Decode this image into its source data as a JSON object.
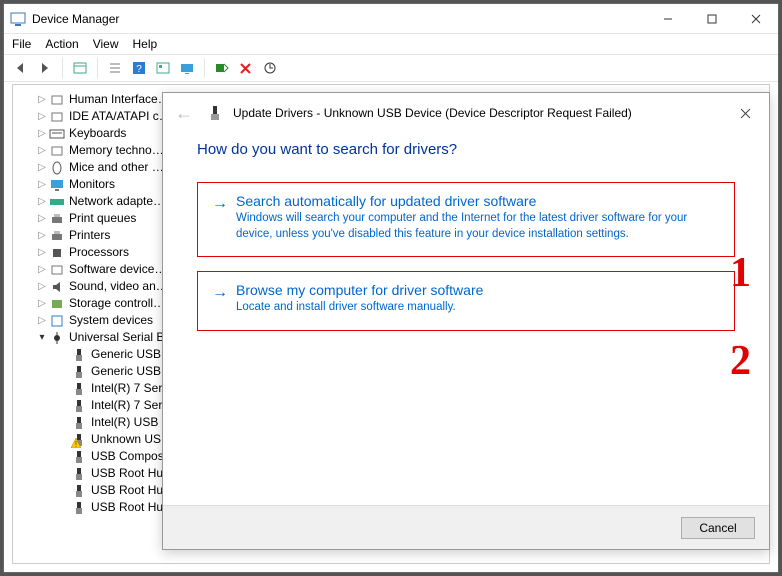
{
  "window": {
    "title": "Device Manager",
    "menu": [
      "File",
      "Action",
      "View",
      "Help"
    ],
    "sys": {
      "min": "–",
      "max": "▢",
      "close": "✕"
    }
  },
  "toolbar_icons": [
    "back",
    "forward",
    "sep",
    "properties",
    "sep",
    "help",
    "blue-q",
    "calendar",
    "monitor",
    "sep",
    "scan",
    "delete",
    "update"
  ],
  "tree": {
    "categories": [
      {
        "label": "Human Interface…",
        "icon": "hid"
      },
      {
        "label": "IDE ATA/ATAPI c…",
        "icon": "ide"
      },
      {
        "label": "Keyboards",
        "icon": "keyboard"
      },
      {
        "label": "Memory techno…",
        "icon": "memory"
      },
      {
        "label": "Mice and other …",
        "icon": "mouse"
      },
      {
        "label": "Monitors",
        "icon": "monitor"
      },
      {
        "label": "Network adapte…",
        "icon": "network"
      },
      {
        "label": "Print queues",
        "icon": "printer"
      },
      {
        "label": "Printers",
        "icon": "printer"
      },
      {
        "label": "Processors",
        "icon": "cpu"
      },
      {
        "label": "Software device…",
        "icon": "software"
      },
      {
        "label": "Sound, video an…",
        "icon": "sound"
      },
      {
        "label": "Storage controll…",
        "icon": "storage"
      },
      {
        "label": "System devices",
        "icon": "system"
      }
    ],
    "expanded": {
      "label": "Universal Serial B…",
      "children": [
        "Generic USB…",
        "Generic USB…",
        "Intel(R) 7 Ser…",
        "Intel(R) 7 Ser…",
        "Intel(R) USB …",
        "Unknown US…",
        "USB Compos…",
        "USB Root Hu…",
        "USB Root Hu…",
        "USB Root Hu…"
      ],
      "warning_index": 5
    }
  },
  "dialog": {
    "title": "Update Drivers - Unknown USB Device (Device Descriptor Request Failed)",
    "heading": "How do you want to search for drivers?",
    "options": [
      {
        "title": "Search automatically for updated driver software",
        "desc": "Windows will search your computer and the Internet for the latest driver software for your device, unless you've disabled this feature in your device installation settings."
      },
      {
        "title": "Browse my computer for driver software",
        "desc": "Locate and install driver software manually."
      }
    ],
    "cancel": "Cancel"
  },
  "annotations": {
    "one": "1",
    "two": "2"
  }
}
